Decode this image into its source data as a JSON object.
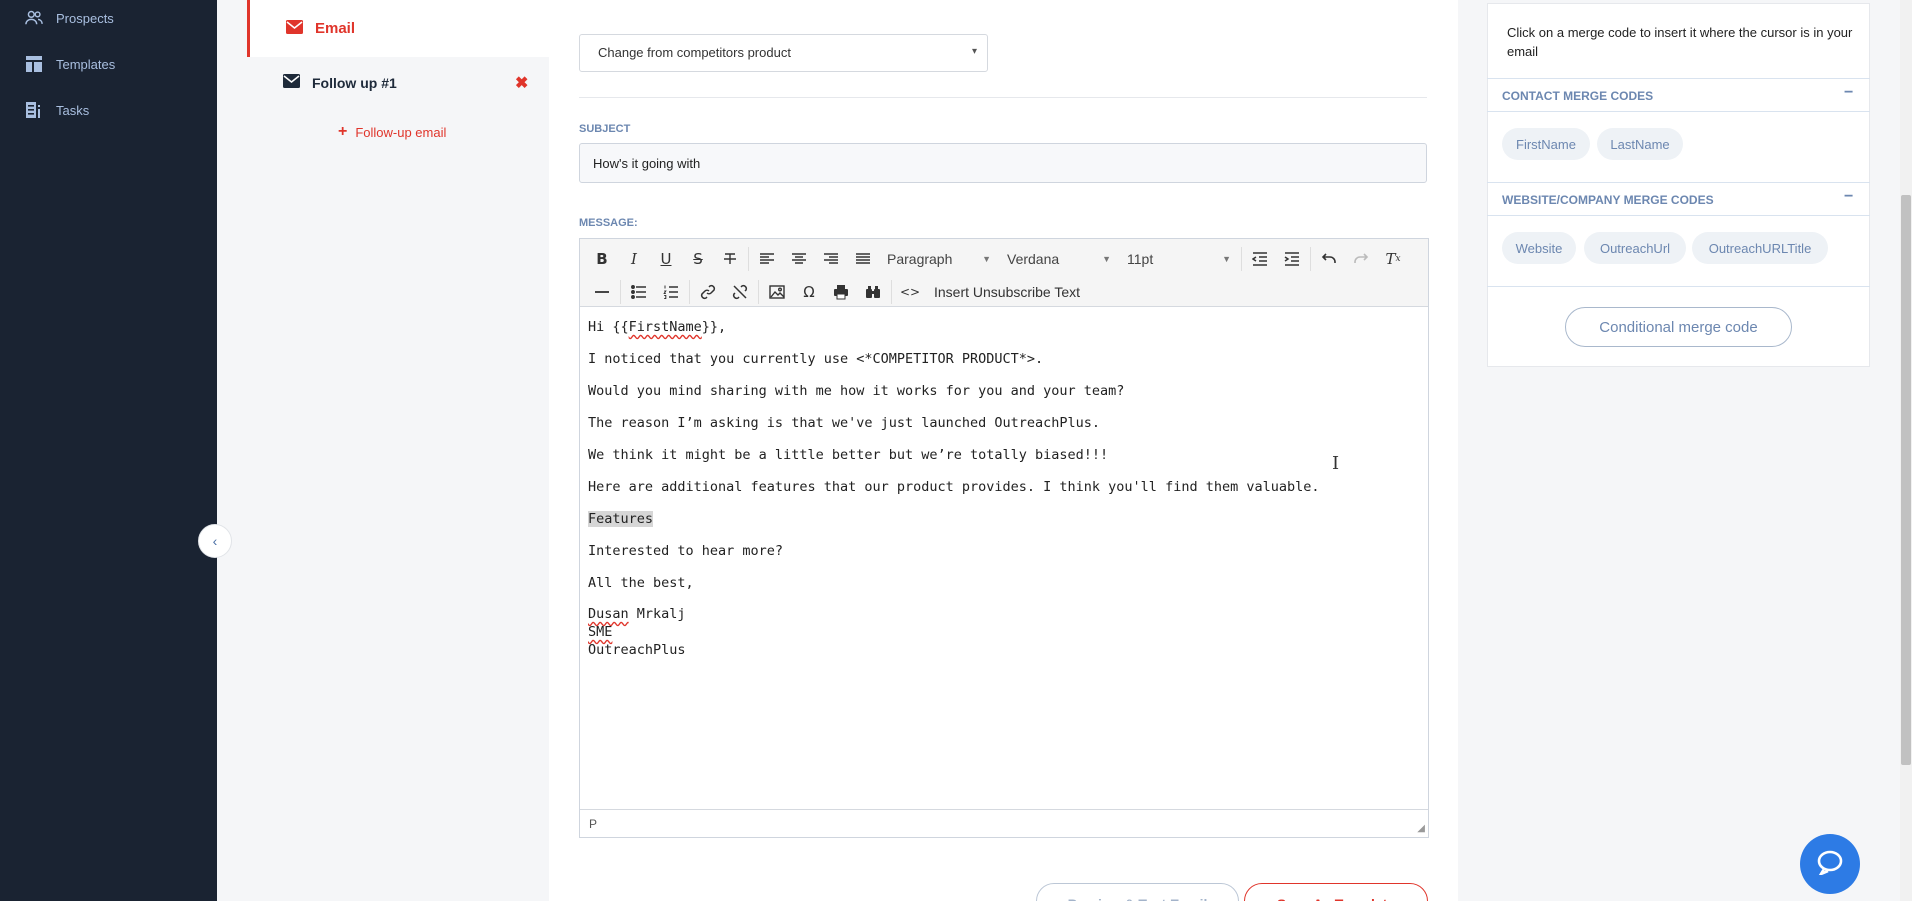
{
  "nav": {
    "items": [
      {
        "label": "Prospects",
        "icon": "users-icon"
      },
      {
        "label": "Templates",
        "icon": "templates-icon"
      },
      {
        "label": "Tasks",
        "icon": "tasks-icon"
      }
    ]
  },
  "steps": {
    "email_label": "Email",
    "followup_label": "Follow up #1",
    "add_followup_label": "Follow-up email"
  },
  "editor": {
    "template_select_value": "Change from competitors product",
    "subject_label": "SUBJECT",
    "subject_value": "How's it going with",
    "message_label": "MESSAGE:",
    "toolbar": {
      "block_format": "Paragraph",
      "font_family": "Verdana",
      "font_size": "11pt",
      "insert_unsubscribe": "Insert Unsubscribe Text"
    },
    "body": {
      "greeting_prefix": "Hi {{",
      "greeting_merge": "FirstName",
      "greeting_suffix": "}},",
      "line1": "I noticed that you currently use <*COMPETITOR PRODUCT*>.",
      "line2": "Would you mind sharing with me how it works for you and your team?",
      "line3": "The reason I’m asking is that we've just launched OutreachPlus.",
      "line4": "We think it might be a little better but we’re totally biased!!!",
      "line5": "Here are additional features that our product provides. I think you'll find them valuable.",
      "line6": "Features",
      "line7": "Interested to hear more?",
      "line8": "All the best,",
      "sig_first": "Dusan",
      "sig_last": " Mrkalj",
      "sig_title": "SME",
      "sig_company": "OutreachPlus"
    },
    "statusbar_path": "P"
  },
  "actions": {
    "preview_label": "Preview & Test Email",
    "save_template_label": "Save As Template"
  },
  "merge_panel": {
    "hint": "Click on a merge code to insert it where the cursor is in your email",
    "contact_header": "CONTACT MERGE CODES",
    "contact_codes": [
      "FirstName",
      "LastName"
    ],
    "website_header": "WEBSITE/COMPANY MERGE CODES",
    "website_codes": [
      "Website",
      "OutreachUrl",
      "OutreachURLTitle"
    ],
    "toggle_symbol": "−",
    "conditional_label": "Conditional merge code"
  },
  "colors": {
    "sidebar_bg": "#1a2332",
    "accent_red": "#e0352b",
    "merge_blue": "#6c87b0",
    "chat_blue": "#2d7be5"
  }
}
